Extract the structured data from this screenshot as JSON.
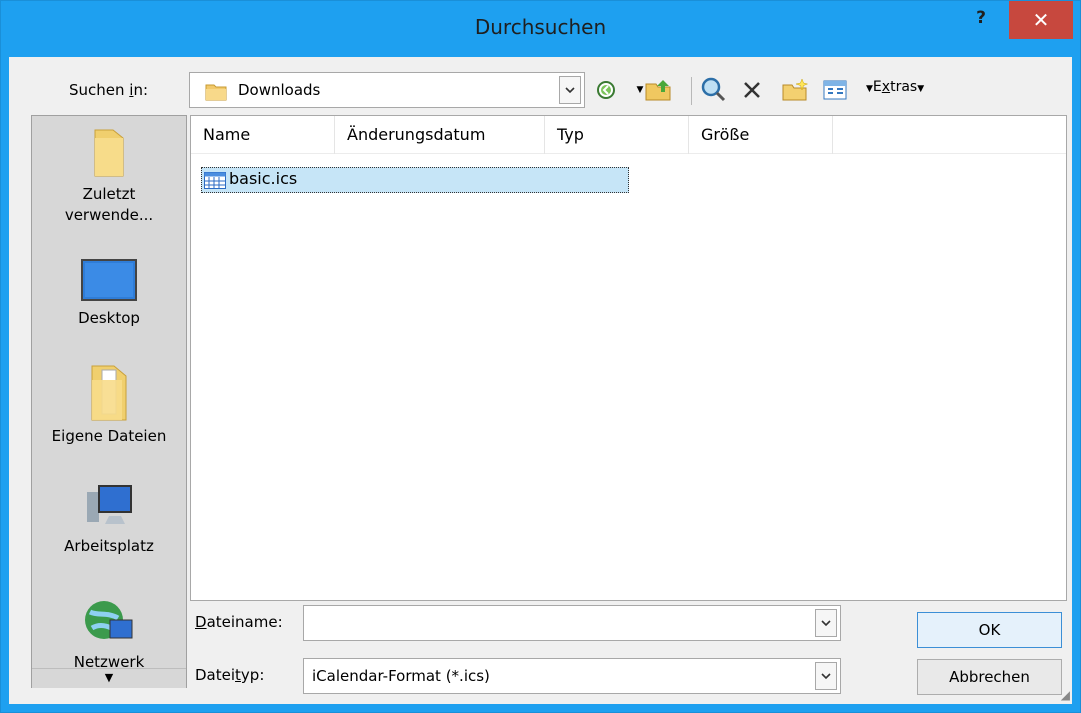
{
  "window": {
    "title": "Durchsuchen",
    "help": "?",
    "close": "✕"
  },
  "toolbar": {
    "lookin_label_pre": "Suchen ",
    "lookin_label_u": "i",
    "lookin_label_post": "n:",
    "lookin_value": "Downloads",
    "extras_pre": "E",
    "extras_u": "x",
    "extras_post": "tras"
  },
  "places": [
    {
      "label_l1": "Zuletzt",
      "label_l2": "verwende...",
      "icon": "folder-icon"
    },
    {
      "label_l1": "Desktop",
      "icon": "desktop-icon"
    },
    {
      "label_l1": "Eigene Dateien",
      "icon": "documents-folder-icon"
    },
    {
      "label_l1": "Arbeitsplatz",
      "icon": "computer-icon"
    },
    {
      "label_l1": "Netzwerk",
      "icon": "network-icon"
    }
  ],
  "filelist": {
    "columns": [
      "Name",
      "Änderungsdatum",
      "Typ",
      "Größe"
    ],
    "files": [
      {
        "name": "basic.ics",
        "icon": "calendar-file-icon",
        "selected": true
      }
    ]
  },
  "form": {
    "filename_label_u": "D",
    "filename_label_rest": "ateiname:",
    "filename_value": "",
    "filetype_label_pre": "Datei",
    "filetype_label_u": "t",
    "filetype_label_post": "yp:",
    "filetype_value": "iCalendar-Format (*.ics)"
  },
  "buttons": {
    "ok": "OK",
    "cancel": "Abbrechen"
  },
  "colors": {
    "titlebar": "#1ea0f0",
    "close": "#c7483e",
    "selection": "#c6e5f7"
  }
}
